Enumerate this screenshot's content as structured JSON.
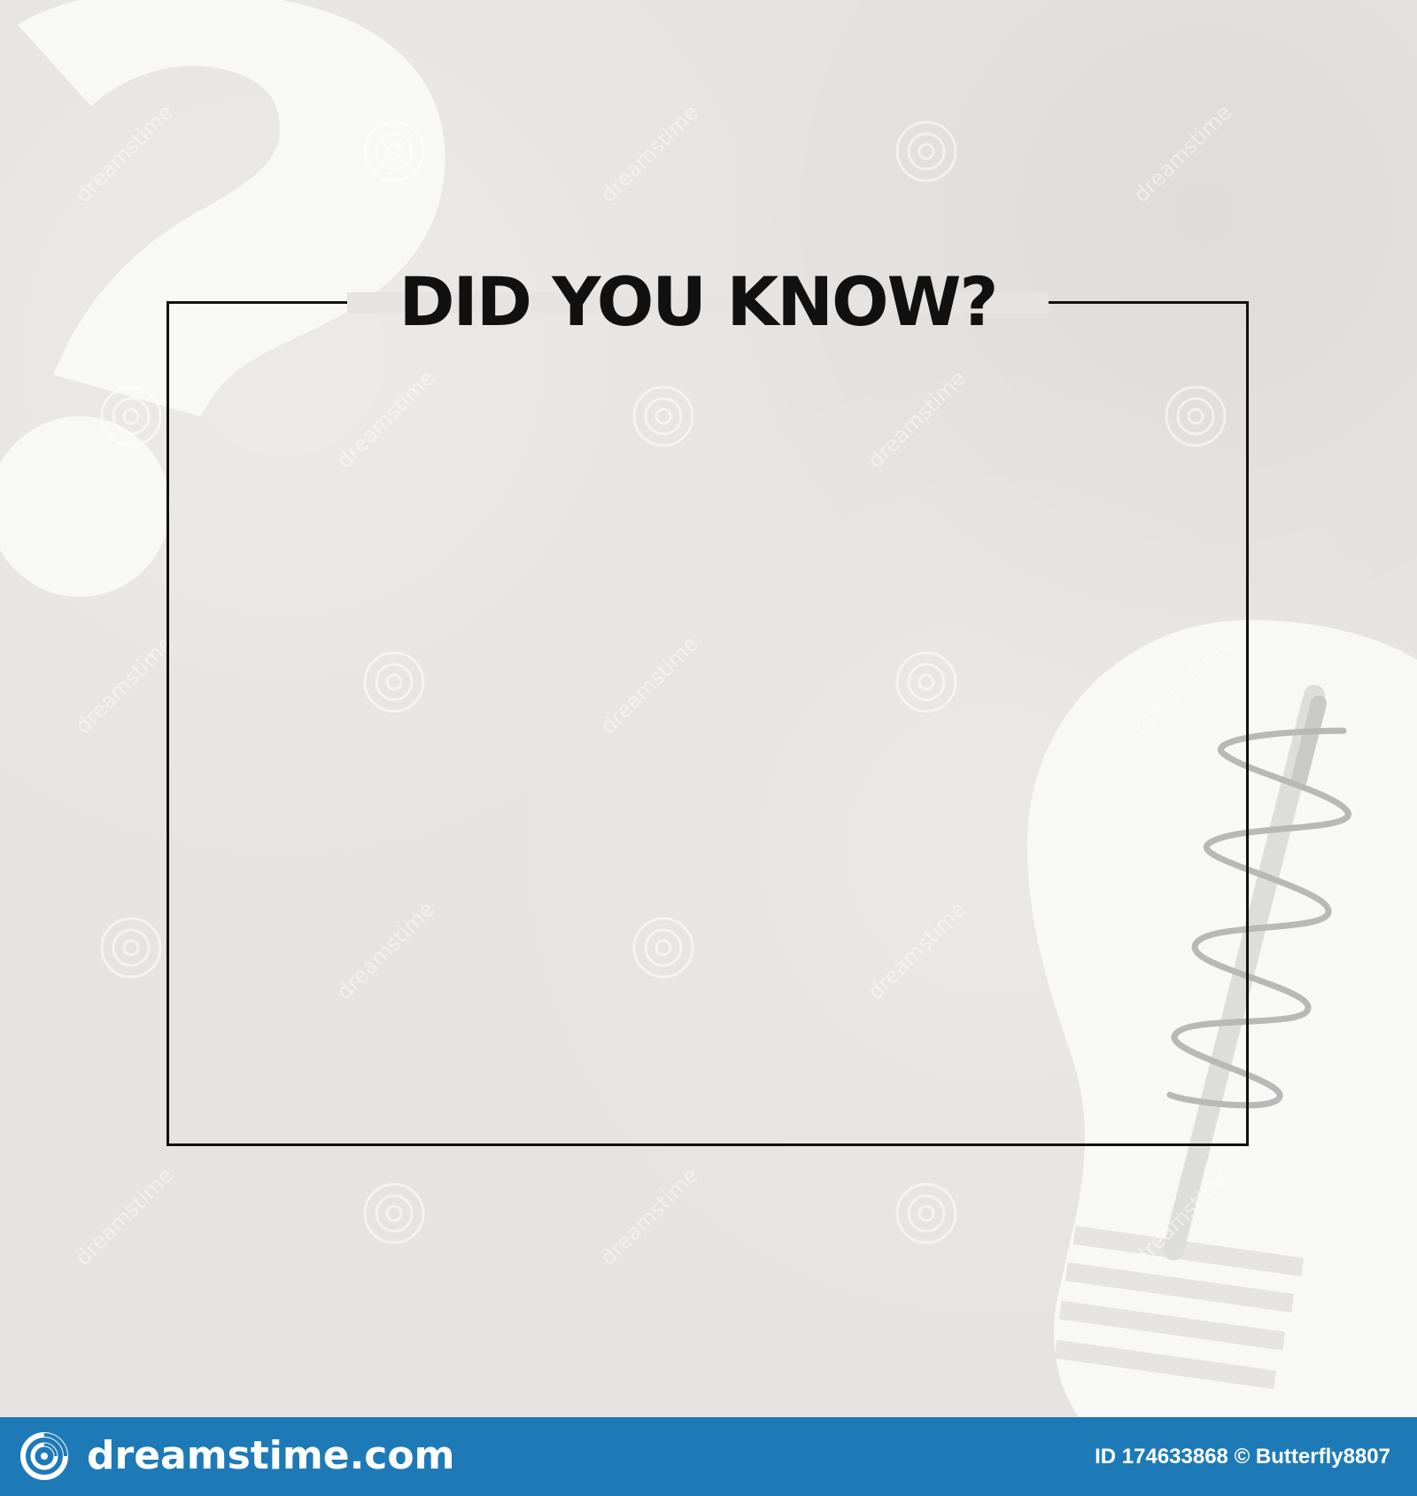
{
  "header": {
    "title": "DID YOU KNOW?"
  },
  "background": {
    "question_mark_icon": "question-mark",
    "lightbulb_icon": "lightbulb"
  },
  "watermark": {
    "repeated_text": "dreamstime"
  },
  "footer": {
    "wordmark": "dreamstime.com",
    "credit": "ID 174633868 © Butterfly8807",
    "logo_icon": "spiral-logo"
  },
  "colors": {
    "background": "#e6e4e2",
    "frame": "#111111",
    "title": "#111111",
    "footer": "#1d7ab7",
    "footer_text": "#ffffff",
    "decor": "#f8f8f7",
    "filament": "#b8b8b8"
  }
}
